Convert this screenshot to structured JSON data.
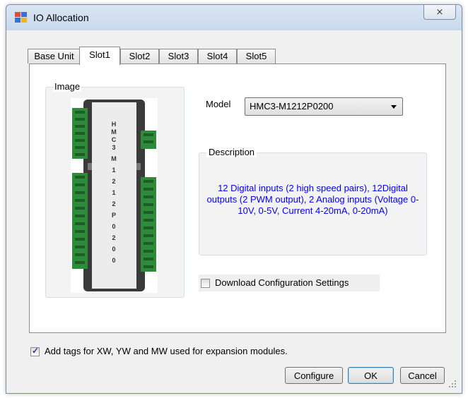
{
  "window": {
    "title": "IO Allocation",
    "close_glyph": "⨯"
  },
  "tabs": [
    {
      "label": "Base Unit"
    },
    {
      "label": "Slot1",
      "active": true
    },
    {
      "label": "Slot2"
    },
    {
      "label": "Slot3"
    },
    {
      "label": "Slot4"
    },
    {
      "label": "Slot5"
    }
  ],
  "image_group": {
    "label": "Image",
    "device_text": "HMC3-M1212P0200"
  },
  "model": {
    "label": "Model",
    "selected": "HMC3-M1212P0200"
  },
  "description": {
    "label": "Description",
    "text": "12 Digital inputs (2 high speed pairs), 12Digital outputs (2 PWM output), 2 Analog inputs (Voltage 0-10V, 0-5V, Current 4-20mA, 0-20mA)"
  },
  "download_config": {
    "label": "Download Configuration Settings",
    "checked": false
  },
  "add_tags": {
    "label": "Add tags for XW, YW and MW used for expansion  modules.",
    "checked": true
  },
  "buttons": {
    "configure": "Configure",
    "ok": "OK",
    "cancel": "Cancel"
  },
  "colors": {
    "description_text": "#0000ff",
    "terminal_green": "#2e8b3a",
    "device_body": "#ececec"
  }
}
